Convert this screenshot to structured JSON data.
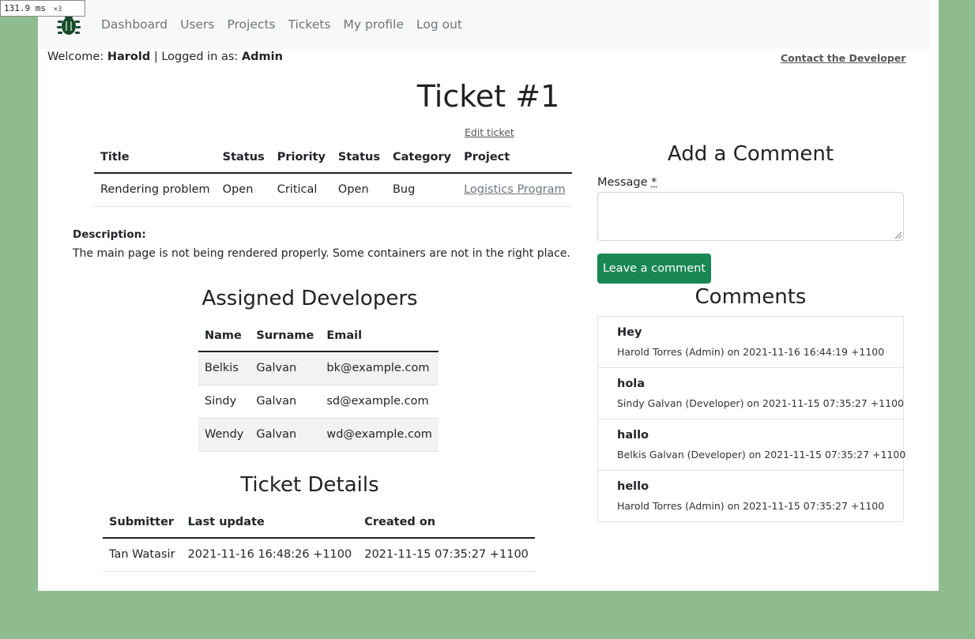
{
  "perf": {
    "value": "131.9",
    "unit": "ms",
    "multiplier": "×3"
  },
  "nav": {
    "logo_icon": "bug-icon",
    "links": [
      "Dashboard",
      "Users",
      "Projects",
      "Tickets",
      "My profile",
      "Log out"
    ]
  },
  "welcome": {
    "prefix": "Welcome:",
    "user": "Harold",
    "separator": "| Logged in as:",
    "role": "Admin"
  },
  "contact_link": "Contact the Developer",
  "page_title": "Ticket #1",
  "edit_link": "Edit ticket",
  "ticket_table": {
    "headers": [
      "Title",
      "Status",
      "Priority",
      "Status",
      "Category",
      "Project"
    ],
    "row": {
      "title": "Rendering problem",
      "status": "Open",
      "priority": "Critical",
      "status2": "Open",
      "category": "Bug",
      "project": "Logistics Program"
    }
  },
  "description": {
    "label": "Description:",
    "text": "The main page is not being rendered properly. Some containers are not in the right place."
  },
  "assigned": {
    "title": "Assigned Developers",
    "headers": [
      "Name",
      "Surname",
      "Email"
    ],
    "rows": [
      [
        "Belkis",
        "Galvan",
        "bk@example.com"
      ],
      [
        "Sindy",
        "Galvan",
        "sd@example.com"
      ],
      [
        "Wendy",
        "Galvan",
        "wd@example.com"
      ]
    ]
  },
  "details": {
    "title": "Ticket Details",
    "headers": [
      "Submitter",
      "Last update",
      "Created on"
    ],
    "row": [
      "Tan Watasir",
      "2021-11-16 16:48:26 +1100",
      "2021-11-15 07:35:27 +1100"
    ]
  },
  "add_comment": {
    "title": "Add a Comment",
    "label": "Message",
    "required_mark": "*",
    "value": "",
    "button": "Leave a comment"
  },
  "comments": {
    "title": "Comments",
    "items": [
      {
        "message": "Hey",
        "meta": "Harold Torres (Admin) on 2021-11-16 16:44:19 +1100"
      },
      {
        "message": "hola",
        "meta": "Sindy Galvan (Developer) on 2021-11-15 07:35:27 +1100"
      },
      {
        "message": "hallo",
        "meta": "Belkis Galvan (Developer) on 2021-11-15 07:35:27 +1100"
      },
      {
        "message": "hello",
        "meta": "Harold Torres (Admin) on 2021-11-15 07:35:27 +1100"
      }
    ]
  },
  "colors": {
    "background": "#8fbc8f",
    "button": "#198754",
    "nav_bg": "#f8f8f8"
  }
}
